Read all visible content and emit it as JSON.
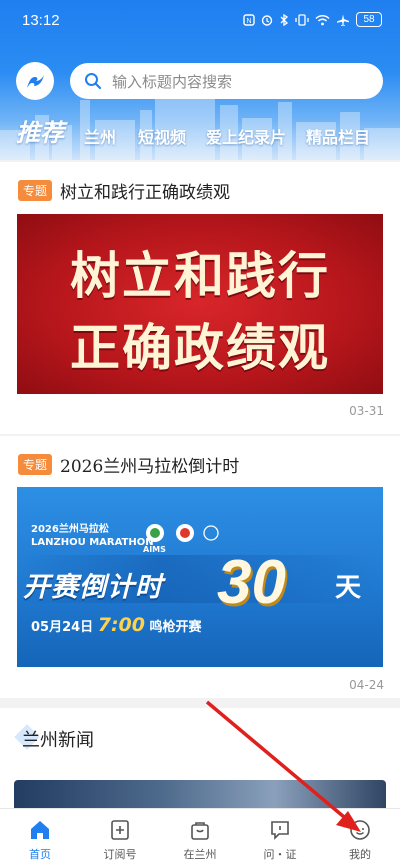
{
  "status_bar": {
    "time": "13:12",
    "battery": "58",
    "icons": [
      "nfc-icon",
      "alarm-icon",
      "bluetooth-icon",
      "vibrate-icon",
      "wifi-icon",
      "airplane-icon",
      "battery-icon"
    ]
  },
  "header": {
    "search_placeholder": "输入标题内容搜索",
    "tabs": [
      {
        "label": "推荐",
        "active": true
      },
      {
        "label": "兰州",
        "active": false
      },
      {
        "label": "短视频",
        "active": false
      },
      {
        "label": "爱上纪录片",
        "active": false
      },
      {
        "label": "精品栏目",
        "active": false
      }
    ]
  },
  "cards": [
    {
      "tag": "专题",
      "title": "树立和践行正确政绩观",
      "banner_lines": [
        "树立和践行",
        "正确政绩观"
      ],
      "date": "03-31"
    },
    {
      "tag": "专题",
      "title": "2026兰州马拉松倒计时",
      "date": "04-24",
      "banner": {
        "event_name": "2026兰州马拉松",
        "event_en": "LANZHOU MARATHON",
        "aims": "AIMS",
        "headline": "开赛倒计时",
        "days": "30",
        "unit": "天",
        "start_date": "05月24日",
        "start_time": "7:00",
        "start_suffix": "鸣枪开赛"
      }
    }
  ],
  "section": {
    "title": "兰州新闻"
  },
  "bottom_nav": [
    {
      "label": "首页",
      "icon": "home-icon",
      "active": true
    },
    {
      "label": "订阅号",
      "icon": "subscribe-icon",
      "active": false
    },
    {
      "label": "在兰州",
      "icon": "bag-icon",
      "active": false
    },
    {
      "label": "问・证",
      "icon": "chat-icon",
      "active": false
    },
    {
      "label": "我的",
      "icon": "profile-icon",
      "active": false
    }
  ],
  "colors": {
    "primary": "#1f7ff0",
    "tag": "#f58c3d",
    "annotation_arrow": "#e0201c"
  }
}
